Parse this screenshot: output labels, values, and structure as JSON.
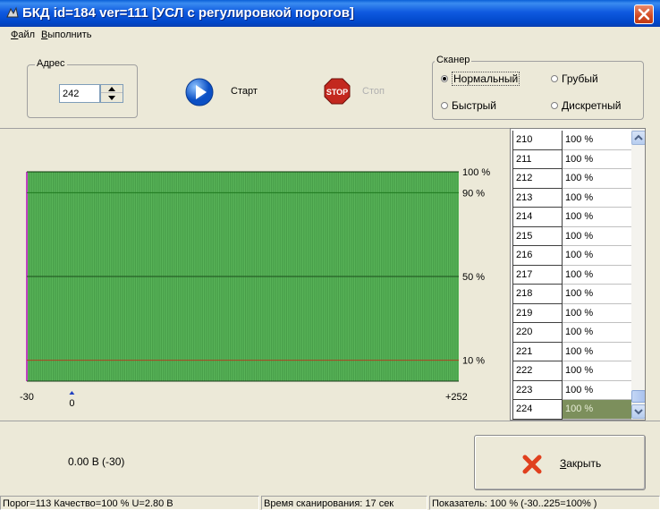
{
  "window": {
    "title": "БКД id=184 ver=111 [УСЛ с регулировкой порогов]"
  },
  "menu": {
    "items": [
      "Файл",
      "Выполнить"
    ]
  },
  "address": {
    "group_label": "Адрес",
    "value": "242"
  },
  "actions": {
    "start_label": "Старт",
    "stop_label": "Стоп"
  },
  "scanner": {
    "group_label": "Сканер",
    "options": [
      {
        "label": "Нормальный",
        "checked": true
      },
      {
        "label": "Грубый",
        "checked": false
      },
      {
        "label": "Быстрый",
        "checked": false
      },
      {
        "label": "Дискретный",
        "checked": false
      }
    ]
  },
  "chart_data": {
    "type": "bar",
    "x_min": -30,
    "x_max": 252,
    "x_min_label": "-30",
    "x_max_label": "+252",
    "marker_value": 0,
    "marker_label": "0",
    "y_unit": "%",
    "ylim": [
      0,
      100
    ],
    "y_ticks": [
      {
        "value": 100,
        "label": "100 %"
      },
      {
        "value": 90,
        "label": "90 %"
      },
      {
        "value": 50,
        "label": "50 %"
      },
      {
        "value": 10,
        "label": "10 %"
      }
    ],
    "value_all_bars": 100,
    "colors": {
      "bar": "#5cb85c",
      "bar_dark": "#2e7d32",
      "line_90": "#1f7a1f",
      "line_50": "#1b4d1b",
      "line_10": "#b04020",
      "marker": "#1f3fc0"
    }
  },
  "table": {
    "rows": [
      {
        "index": "210",
        "value": "100 %"
      },
      {
        "index": "211",
        "value": "100 %"
      },
      {
        "index": "212",
        "value": "100 %"
      },
      {
        "index": "213",
        "value": "100 %"
      },
      {
        "index": "214",
        "value": "100 %"
      },
      {
        "index": "215",
        "value": "100 %"
      },
      {
        "index": "216",
        "value": "100 %"
      },
      {
        "index": "217",
        "value": "100 %"
      },
      {
        "index": "218",
        "value": "100 %"
      },
      {
        "index": "219",
        "value": "100 %"
      },
      {
        "index": "220",
        "value": "100 %"
      },
      {
        "index": "221",
        "value": "100 %"
      },
      {
        "index": "222",
        "value": "100 %"
      },
      {
        "index": "223",
        "value": "100 %"
      },
      {
        "index": "224",
        "value": "100 %"
      }
    ],
    "selected_index": "224"
  },
  "bottom": {
    "voltage_text": "0.00 В (-30)",
    "close_label": "Закрыть"
  },
  "status": {
    "cell1": "Порог=113  Качество=100 %   U=2.80 В",
    "cell2": "Время сканирования: 17 сек",
    "cell3": "Показатель: 100 % (-30..225=100% )"
  },
  "icons": {
    "app": "app-icon",
    "close": "close-icon",
    "start": "play-icon",
    "stop": "stop-icon",
    "close_button": "red-x-icon"
  }
}
